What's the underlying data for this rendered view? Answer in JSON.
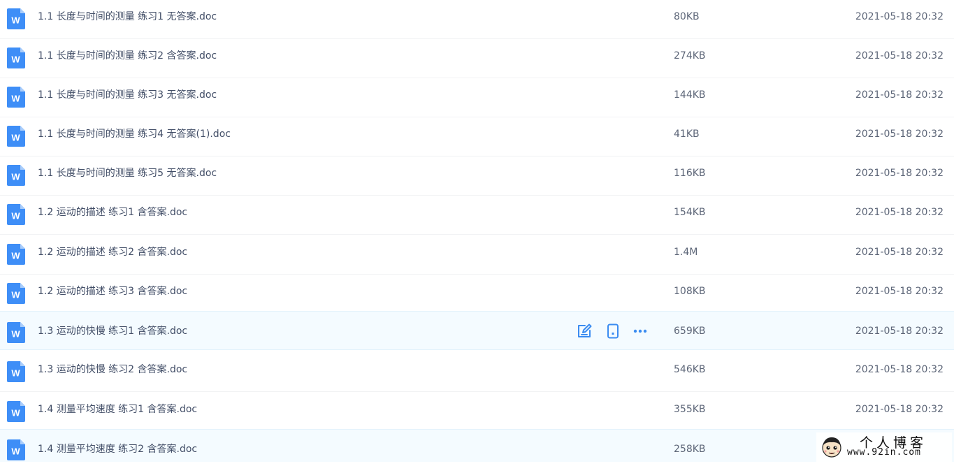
{
  "files": [
    {
      "name": "1.1 长度与时间的测量 练习1 无答案.doc",
      "size": "80KB",
      "date": "2021-05-18 20:32",
      "icon": "word-doc-icon"
    },
    {
      "name": "1.1 长度与时间的测量 练习2 含答案.doc",
      "size": "274KB",
      "date": "2021-05-18 20:32",
      "icon": "word-doc-icon"
    },
    {
      "name": "1.1 长度与时间的测量 练习3 无答案.doc",
      "size": "144KB",
      "date": "2021-05-18 20:32",
      "icon": "word-doc-icon"
    },
    {
      "name": "1.1 长度与时间的测量 练习4 无答案(1).doc",
      "size": "41KB",
      "date": "2021-05-18 20:32",
      "icon": "word-doc-icon"
    },
    {
      "name": "1.1 长度与时间的测量 练习5 无答案.doc",
      "size": "116KB",
      "date": "2021-05-18 20:32",
      "icon": "word-doc-icon"
    },
    {
      "name": "1.2 运动的描述 练习1 含答案.doc",
      "size": "154KB",
      "date": "2021-05-18 20:32",
      "icon": "word-doc-icon"
    },
    {
      "name": "1.2 运动的描述 练习2 含答案.doc",
      "size": "1.4M",
      "date": "2021-05-18 20:32",
      "icon": "word-doc-icon"
    },
    {
      "name": "1.2 运动的描述 练习3 含答案.doc",
      "size": "108KB",
      "date": "2021-05-18 20:32",
      "icon": "word-doc-icon"
    },
    {
      "name": "1.3 运动的快慢 练习1 含答案.doc",
      "size": "659KB",
      "date": "2021-05-18 20:32",
      "icon": "word-doc-icon"
    },
    {
      "name": "1.3 运动的快慢 练习2 含答案.doc",
      "size": "546KB",
      "date": "2021-05-18 20:32",
      "icon": "word-doc-icon"
    },
    {
      "name": "1.4 测量平均速度 练习1 含答案.doc",
      "size": "355KB",
      "date": "2021-05-18 20:32",
      "icon": "word-doc-icon"
    },
    {
      "name": "1.4 测量平均速度 练习2 含答案.doc",
      "size": "258KB",
      "date": "",
      "icon": "word-doc-icon"
    }
  ],
  "hovered_row_actions": [
    "edit-icon",
    "phone-icon",
    "more-icon"
  ],
  "watermark": {
    "title": "个人博客",
    "url": "www.92in.com"
  },
  "colors": {
    "accent": "#3b8cf1",
    "icon_blue": "#3e8ef7",
    "hover_bg": "#f4fbff"
  }
}
